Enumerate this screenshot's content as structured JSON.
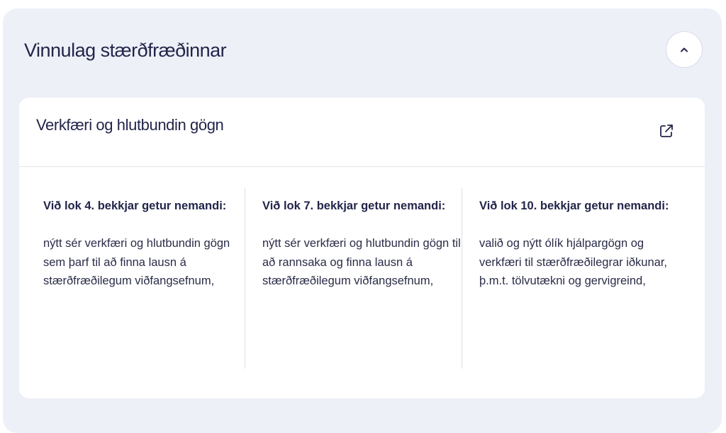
{
  "section": {
    "title": "Vinnulag stærðfræðinnar",
    "collapse_icon": "chevron-up-icon"
  },
  "card": {
    "title": "Verkfæri og hlutbundin gögn",
    "link_icon": "external-link-icon",
    "columns": [
      {
        "heading": "Við lok 4. bekkjar getur nemandi:",
        "text": "nýtt sér verkfæri og hlutbundin gögn sem þarf til að finna lausn á stærðfræðilegum viðfangsefnum,"
      },
      {
        "heading": "Við lok 7. bekkjar getur nemandi:",
        "text": "nýtt sér verkfæri og hlutbundin gögn til að rannsaka og finna lausn á stærðfræðilegum viðfangsefnum,"
      },
      {
        "heading": "Við lok 10. bekkjar getur nemandi:",
        "text": "valið og nýtt ólík hjálpargögn og verkfæri til stærðfræðilegrar iðkunar, þ.m.t. tölvutækni og gervigreind,"
      }
    ]
  },
  "colors": {
    "panel_bg": "#eef0f8",
    "card_bg": "#ffffff",
    "text_dark": "#23254a",
    "divider": "#dcdfe8"
  }
}
